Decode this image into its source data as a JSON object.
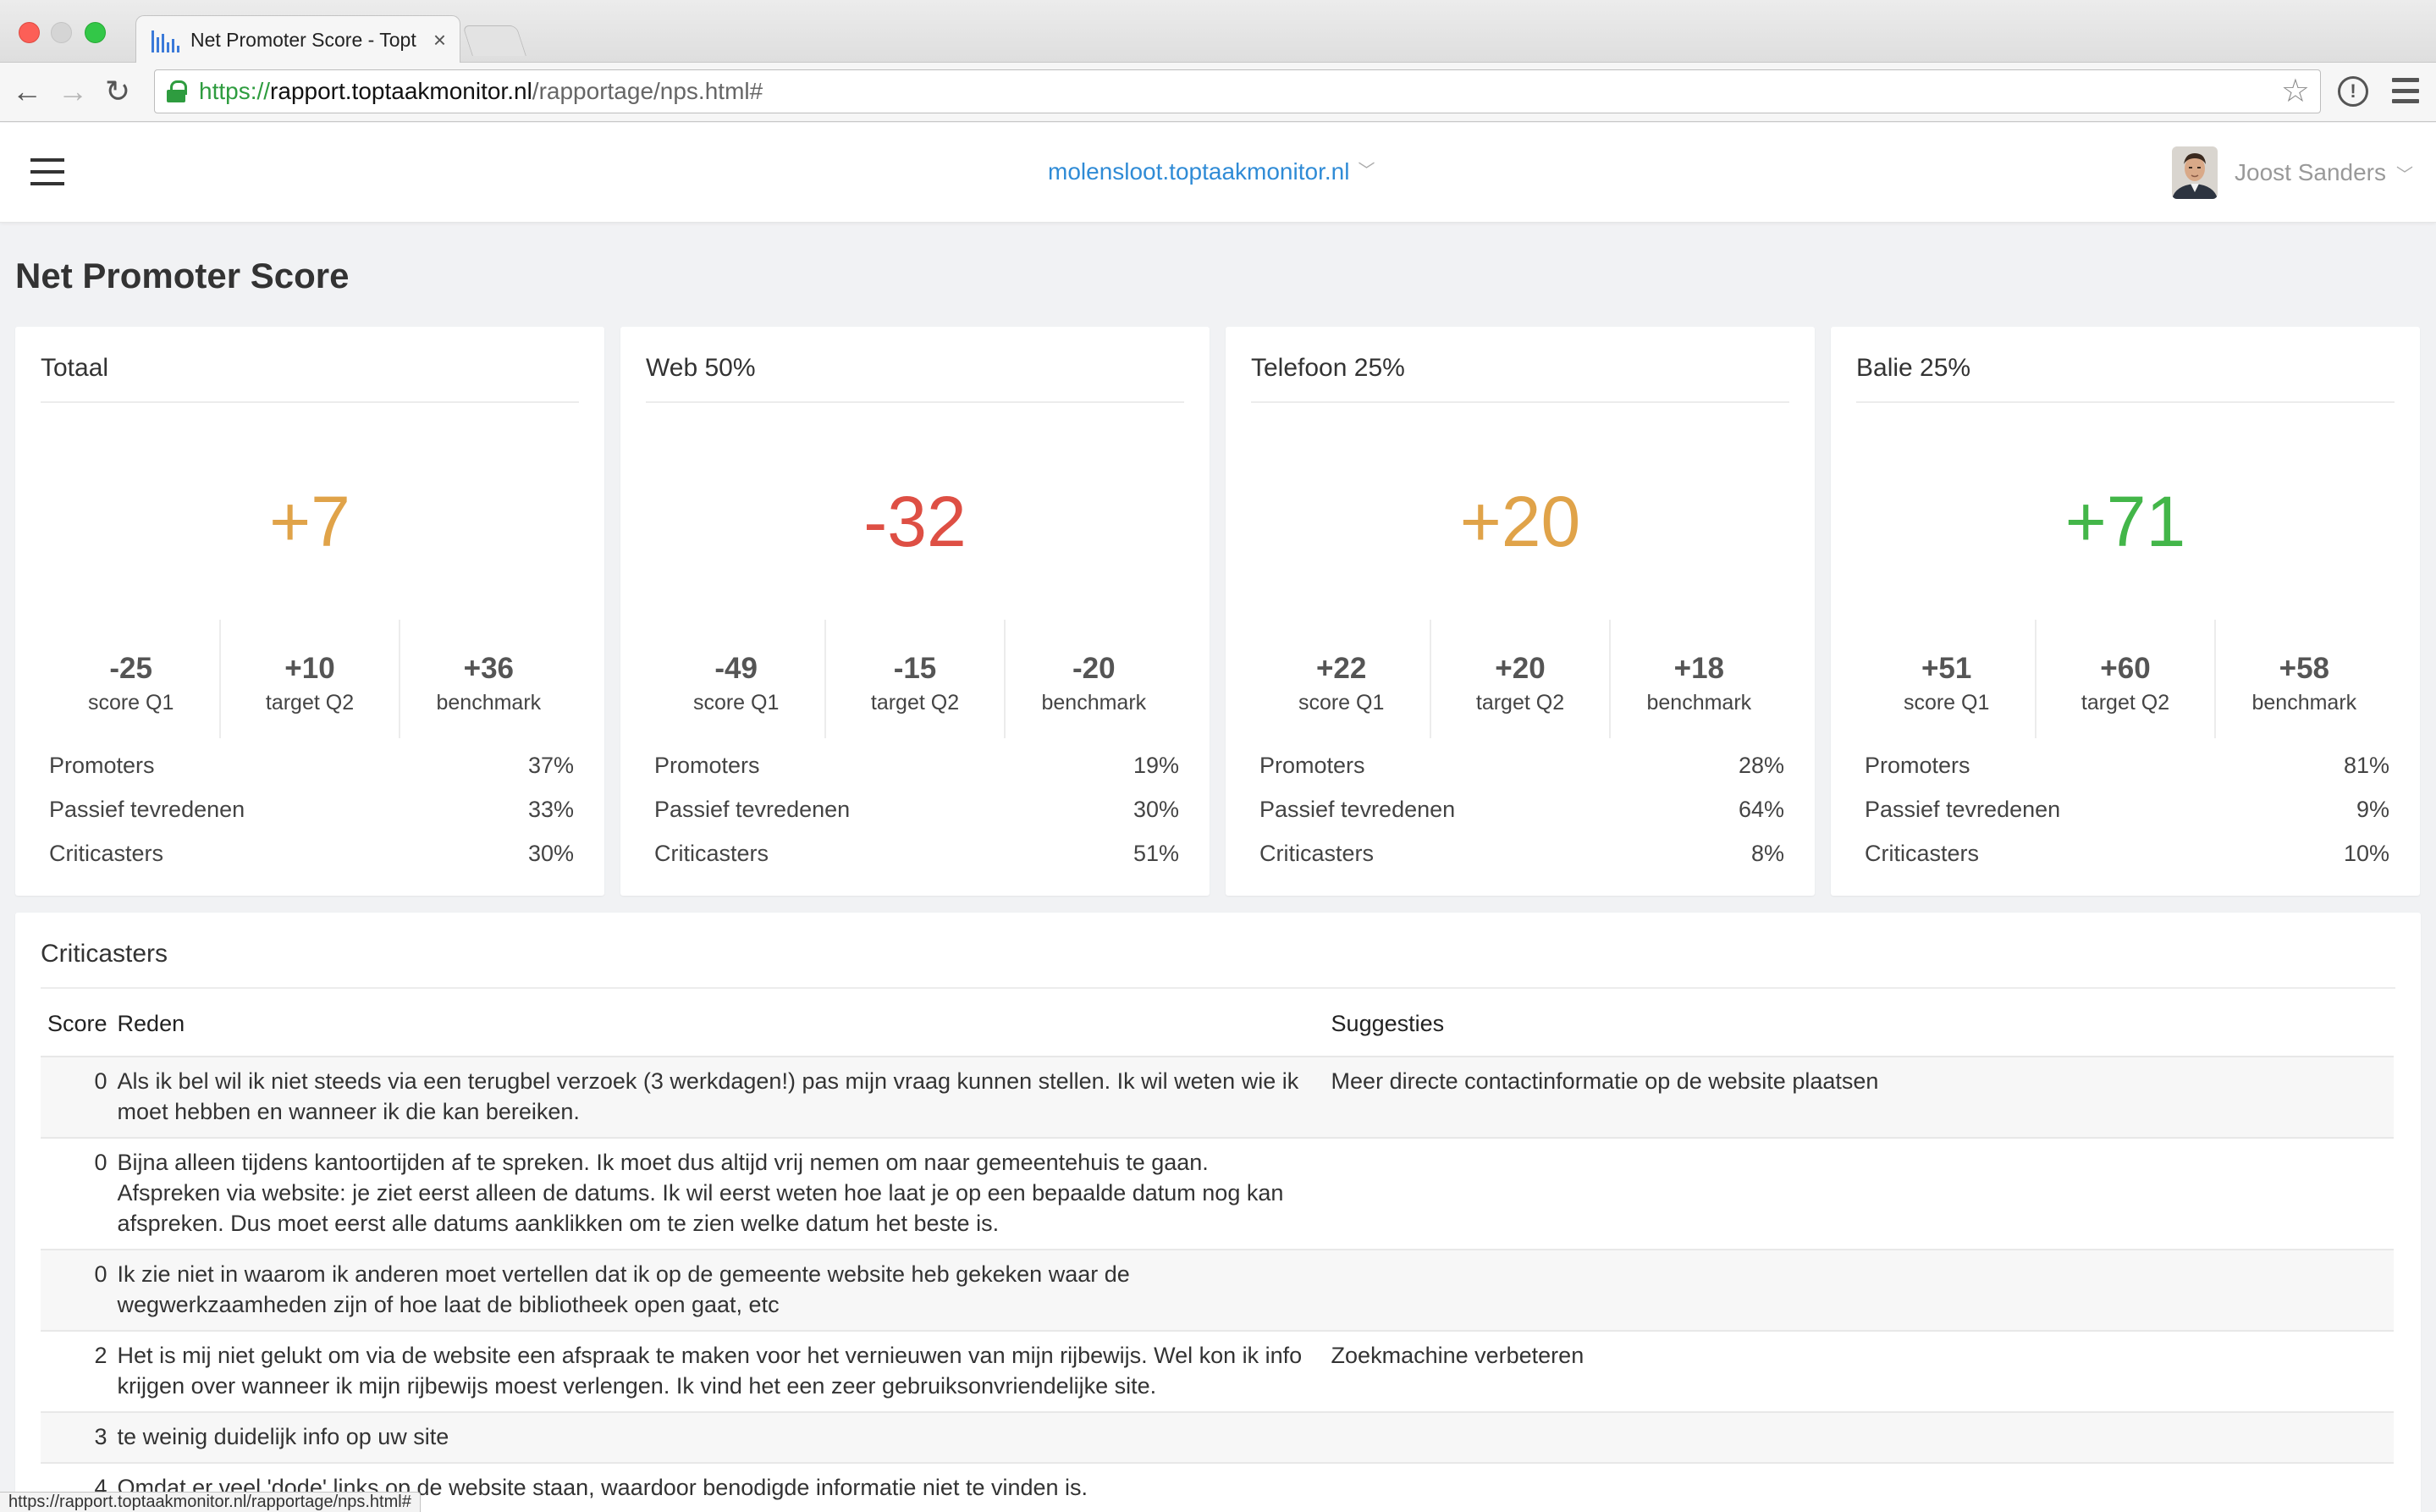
{
  "browser": {
    "tab_title": "Net Promoter Score - Topt",
    "url_scheme": "https://",
    "url_host": "rapport.toptaakmonitor.nl",
    "url_path": "/rapportage/nps.html#",
    "status_url": "https://rapport.toptaakmonitor.nl/rapportage/nps.html#"
  },
  "header": {
    "site": "molensloot.toptaakmonitor.nl",
    "user_name": "Joost Sanders"
  },
  "page_title": "Net Promoter Score",
  "colors": {
    "score_orange": "#e0a349",
    "score_red": "#de4f44",
    "score_green": "#43b649"
  },
  "cards": [
    {
      "title": "Totaal",
      "score": "+7",
      "stats": [
        {
          "value": "-25",
          "label": "score Q1"
        },
        {
          "value": "+10",
          "label": "target Q2"
        },
        {
          "value": "+36",
          "label": "benchmark"
        }
      ],
      "rows": [
        {
          "label": "Promoters",
          "value": "37%"
        },
        {
          "label": "Passief tevredenen",
          "value": "33%"
        },
        {
          "label": "Criticasters",
          "value": "30%"
        }
      ]
    },
    {
      "title": "Web 50%",
      "score": "-32",
      "stats": [
        {
          "value": "-49",
          "label": "score Q1"
        },
        {
          "value": "-15",
          "label": "target Q2"
        },
        {
          "value": "-20",
          "label": "benchmark"
        }
      ],
      "rows": [
        {
          "label": "Promoters",
          "value": "19%"
        },
        {
          "label": "Passief tevredenen",
          "value": "30%"
        },
        {
          "label": "Criticasters",
          "value": "51%"
        }
      ]
    },
    {
      "title": "Telefoon 25%",
      "score": "+20",
      "stats": [
        {
          "value": "+22",
          "label": "score Q1"
        },
        {
          "value": "+20",
          "label": "target Q2"
        },
        {
          "value": "+18",
          "label": "benchmark"
        }
      ],
      "rows": [
        {
          "label": "Promoters",
          "value": "28%"
        },
        {
          "label": "Passief tevredenen",
          "value": "64%"
        },
        {
          "label": "Criticasters",
          "value": "8%"
        }
      ]
    },
    {
      "title": "Balie 25%",
      "score": "+71",
      "stats": [
        {
          "value": "+51",
          "label": "score Q1"
        },
        {
          "value": "+60",
          "label": "target Q2"
        },
        {
          "value": "+58",
          "label": "benchmark"
        }
      ],
      "rows": [
        {
          "label": "Promoters",
          "value": "81%"
        },
        {
          "label": "Passief tevredenen",
          "value": "9%"
        },
        {
          "label": "Criticasters",
          "value": "10%"
        }
      ]
    }
  ],
  "criticasters": {
    "title": "Criticasters",
    "columns": {
      "score": "Score",
      "reason": "Reden",
      "suggestion": "Suggesties"
    },
    "rows": [
      {
        "score": "0",
        "reason": "Als ik bel wil ik niet steeds via een terugbel verzoek (3 werkdagen!) pas mijn vraag kunnen stellen. Ik wil weten wie ik moet hebben en wanneer ik die kan bereiken.",
        "suggestion": "Meer directe contactinformatie op de website plaatsen"
      },
      {
        "score": "0",
        "reason": "Bijna alleen tijdens kantoortijden af te spreken. Ik moet dus altijd vrij nemen om naar gemeentehuis te gaan. Afspreken via website: je ziet eerst alleen de datums. Ik wil eerst weten hoe laat je op een bepaalde datum nog kan afspreken. Dus moet eerst alle datums aanklikken om te zien welke datum het beste is.",
        "suggestion": ""
      },
      {
        "score": "0",
        "reason": "Ik zie niet in waarom ik anderen moet vertellen dat ik op de gemeente website heb gekeken waar de wegwerkzaamheden zijn of hoe laat de bibliotheek open gaat, etc",
        "suggestion": ""
      },
      {
        "score": "2",
        "reason": "Het is mij niet gelukt om via de website een afspraak te maken voor het vernieuwen van mijn rijbewijs. Wel kon ik info krijgen over wanneer ik mijn rijbewijs moest verlengen. Ik vind het een zeer gebruiksonvriendelijke site.",
        "suggestion": "Zoekmachine verbeteren"
      },
      {
        "score": "3",
        "reason": "te weinig duidelijk info op uw site",
        "suggestion": ""
      },
      {
        "score": "4",
        "reason": "Omdat er veel 'dode' links op de website staan, waardoor benodigde informatie niet te vinden is.",
        "suggestion": ""
      }
    ]
  }
}
